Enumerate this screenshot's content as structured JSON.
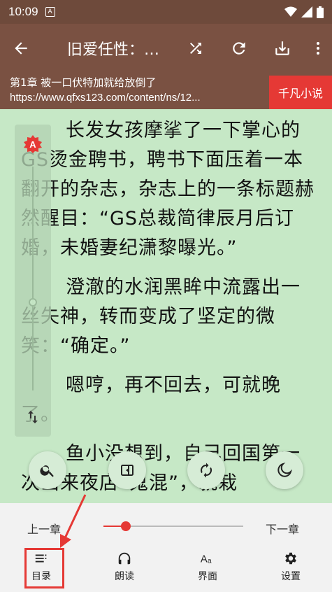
{
  "status": {
    "time": "10:09",
    "notif": "A"
  },
  "appbar": {
    "title": "旧爱任性：总裁,请离婚"
  },
  "chapter": {
    "title": "第1章 被一口伏特加就给放倒了",
    "url": "https://www.qfxs123.com/content/ns/12...",
    "source": "千凡小说"
  },
  "content": {
    "paragraphs": [
      "长发女孩摩挲了一下掌心的GS烫金聘书，聘书下面压着一本翻开的杂志，杂志上的一条标题赫然醒目：“GS总裁简律辰月后订婚，未婚妻纪潇黎曝光。”",
      "澄澈的水润黑眸中流露出一丝失神，转而变成了坚定的微笑：“确定。”",
      "嗯哼，再不回去，可就晚了。",
      "鱼小没想到，自己回国第一次出来夜店“鬼混”，就栽"
    ]
  },
  "side_panel": {
    "auto_label": "A",
    "brightness": 0.6
  },
  "bottom": {
    "prev_label": "上一章",
    "next_label": "下一章",
    "progress": 0.16,
    "items": [
      {
        "label": "目录",
        "icon": "toc-icon"
      },
      {
        "label": "朗读",
        "icon": "headphones-icon"
      },
      {
        "label": "界面",
        "icon": "font-icon"
      },
      {
        "label": "设置",
        "icon": "settings-icon"
      }
    ]
  },
  "colors": {
    "accent": "#e53935",
    "toolbar": "#7a5142",
    "reader_bg": "#c6e8c6"
  }
}
